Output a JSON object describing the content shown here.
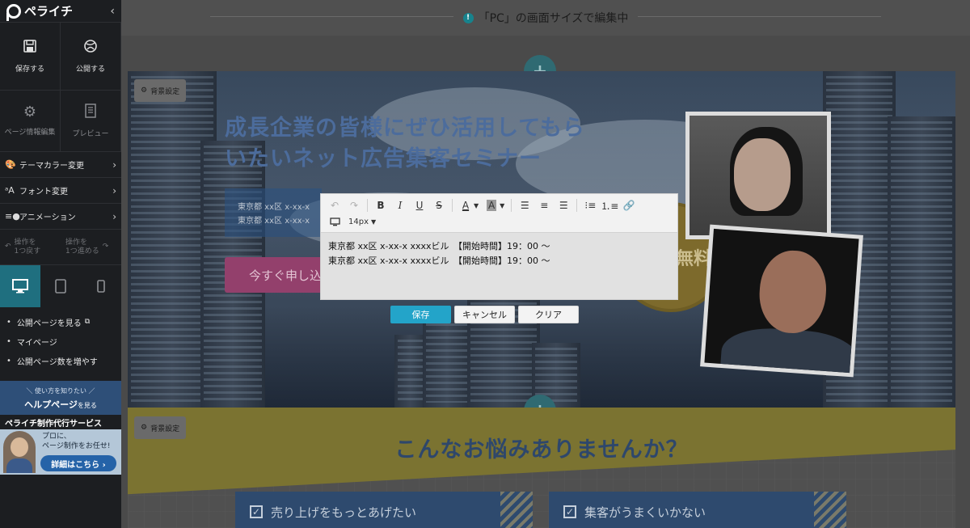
{
  "app": {
    "logo": "ペライチ",
    "collapse": "‹"
  },
  "sidebar": {
    "save": "保存する",
    "publish": "公開する",
    "page_info": "ページ情報編集",
    "preview": "プレビュー",
    "menu": [
      {
        "icon": "palette-icon",
        "label": "テーマカラー変更"
      },
      {
        "icon": "font-icon",
        "label": "フォント変更"
      },
      {
        "icon": "animation-icon",
        "label": "アニメーション"
      }
    ],
    "undo": "操作を\n1つ戻す",
    "redo": "操作を\n1つ進める",
    "links": [
      "公開ページを見る",
      "マイページ",
      "公開ページ数を増やす"
    ],
    "help": {
      "sub": "＼ 使い方を知りたい ／",
      "main": "ヘルプページ",
      "suffix": "を見る"
    },
    "agency": {
      "title": "ペライチ制作代行サービス",
      "line1": "プロに、",
      "line2": "ページ制作をお任せ!",
      "button": "詳細はこちら ›"
    }
  },
  "topbar": {
    "message": "「PC」の画面サイズで編集中"
  },
  "hero": {
    "bg_setting": "背景設定",
    "title_line1": "成長企業の皆様にぜひ活用してもら",
    "title_line2": "いたいネット広告集客セミナー",
    "addr_line1": "東京都 xx区 x-xx-x",
    "addr_line2": "東京都 xx区 x-xx-x",
    "cta": "今すぐ申し込",
    "free": "無料"
  },
  "section2": {
    "bg_setting": "背景設定",
    "title": "こんなお悩みありませんか？",
    "cards": [
      "売り上げをもっとあげたい",
      "集客がうまくいかない"
    ]
  },
  "editor": {
    "font_size": "14px",
    "line1": "東京都 xx区 x-xx-x xxxxビル　【開始時間】19：00 ～",
    "line2": "東京都 xx区 x-xx-x xxxxビル　【開始時間】19：00 ～",
    "save": "保存",
    "cancel": "キャンセル",
    "clear": "クリア"
  }
}
